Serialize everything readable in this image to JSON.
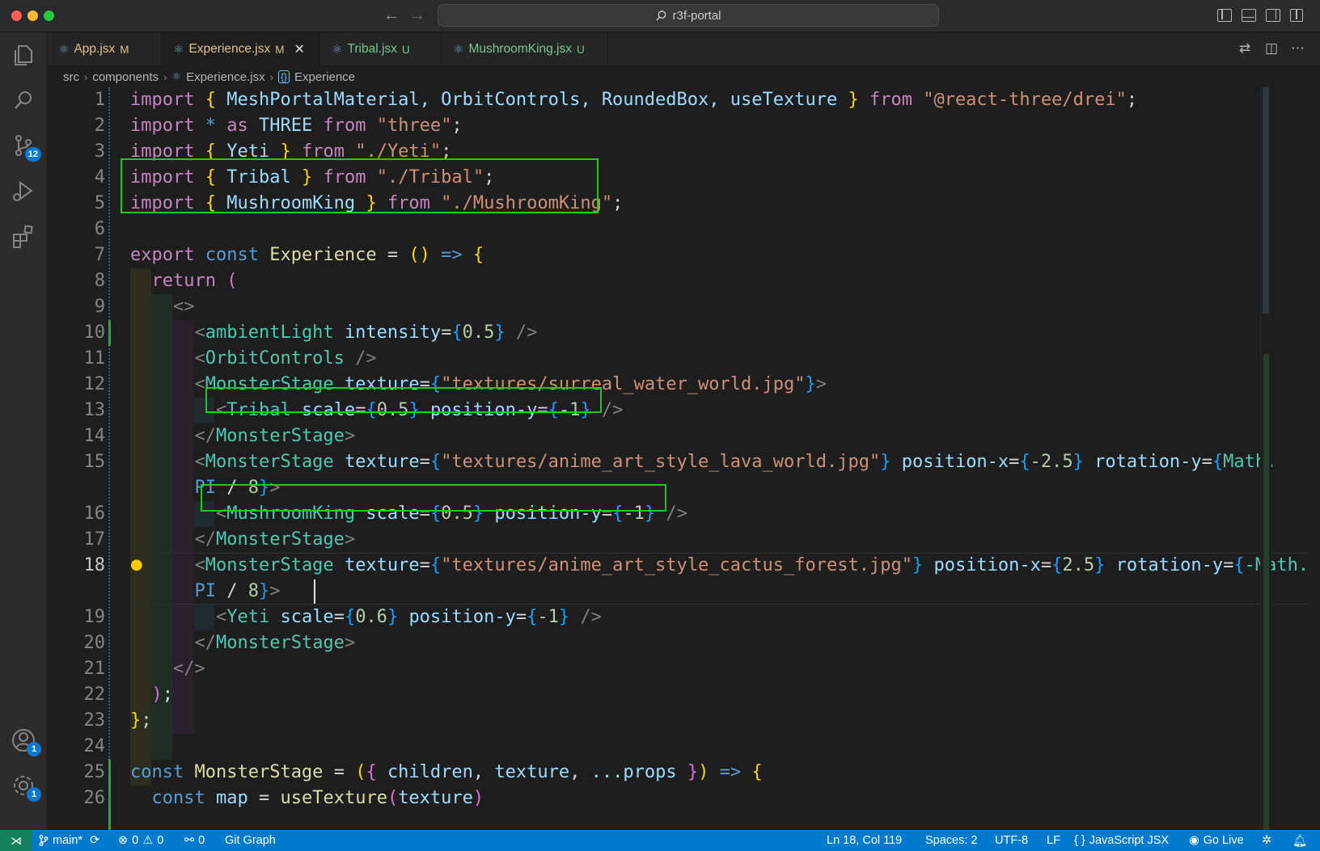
{
  "window": {
    "title": "r3f-portal"
  },
  "tabs": [
    {
      "name": "App.jsx",
      "status": "M",
      "active": false,
      "color": "#e2c08d"
    },
    {
      "name": "Experience.jsx",
      "status": "M",
      "active": true,
      "color": "#e2c08d"
    },
    {
      "name": "Tribal.jsx",
      "status": "U",
      "active": false,
      "color": "#73c991"
    },
    {
      "name": "MushroomKing.jsx",
      "status": "U",
      "active": false,
      "color": "#73c991"
    }
  ],
  "breadcrumb": [
    "src",
    "components",
    "Experience.jsx",
    "Experience"
  ],
  "activity": {
    "source_control_badge": "12",
    "accounts_badge": "1",
    "settings_badge": "1"
  },
  "editor": {
    "lines": [
      "1",
      "2",
      "3",
      "4",
      "5",
      "6",
      "7",
      "8",
      "9",
      "10",
      "11",
      "12",
      "13",
      "14",
      "15",
      "",
      "16",
      "17",
      "18",
      "",
      "19",
      "20",
      "21",
      "22",
      "23",
      "24",
      "25",
      "26"
    ],
    "t": {
      "import": "import",
      "from": "from",
      "as": "as",
      "export": "export",
      "const": "const",
      "return": "return",
      "drei_names": "MeshPortalMaterial, OrbitControls, RoundedBox, useTexture",
      "drei_path": "\"@react-three/drei\"",
      "star": "*",
      "three_ns": "THREE",
      "three_path": "\"three\"",
      "yeti": "Yeti",
      "yeti_path": "\"./Yeti\"",
      "tribal": "Tribal",
      "tribal_path": "\"./Tribal\"",
      "mushroom": "MushroomKing",
      "mushroom_path": "\"./MushroomKing\"",
      "experience": "Experience",
      "arrow": "=>",
      "ambient": "ambientLight",
      "intensity": "intensity",
      "orbit": "OrbitControls",
      "stage": "MonsterStage",
      "texture_attr": "texture",
      "scale": "scale",
      "pos_y": "position-y",
      "pos_x": "position-x",
      "rot_y": "rotation-y",
      "tex1": "\"textures/surreal_water_world.jpg\"",
      "tex2": "\"textures/anime_art_style_lava_world.jpg\"",
      "tex3": "\"textures/anime_art_style_cactus_forest.jpg\"",
      "math": "Math.",
      "neg_math": "-Math.",
      "pi": "PI",
      "n05": "0.5",
      "n06": "0.6",
      "nm1": "-1",
      "nm25": "-2.5",
      "n25": "2.5",
      "n8": "8",
      "children": "children",
      "props": "...props",
      "map": "map",
      "usetexture": "useTexture"
    }
  },
  "statusbar": {
    "branch": "main*",
    "errors": "0",
    "warnings": "0",
    "ports": "0",
    "git_graph": "Git Graph",
    "position": "Ln 18, Col 119",
    "spaces": "Spaces: 2",
    "encoding": "UTF-8",
    "eol": "LF",
    "language": "JavaScript JSX",
    "golive": "Go Live"
  }
}
